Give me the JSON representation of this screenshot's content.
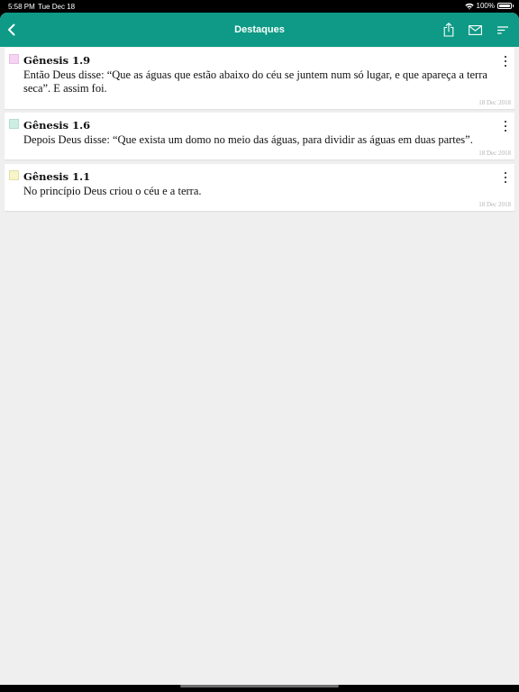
{
  "status_bar": {
    "time": "5:58 PM",
    "date": "Tue Dec 18",
    "battery": "100%",
    "icons": [
      "wifi-icon",
      "battery-icon"
    ]
  },
  "nav": {
    "title": "Destaques",
    "back_icon": "chevron-left-icon",
    "actions": [
      "share-icon",
      "mail-icon",
      "sort-icon"
    ]
  },
  "colors": {
    "accent": "#0e9a86",
    "background": "#efefef",
    "card": "#ffffff",
    "date_text": "#b3b3b3"
  },
  "highlights": [
    {
      "reference": "Gênesis 1.9",
      "text": "Então Deus disse: “Que as águas que estão abaixo do céu se juntem num só lugar, e que apareça a terra seca”. E assim foi.",
      "date": "18 Dec 2018",
      "color": "#f8d2f2"
    },
    {
      "reference": "Gênesis 1.6",
      "text": "Depois Deus disse: “Que exista um domo no meio das águas, para dividir as águas em duas partes”.",
      "date": "18 Dec 2018",
      "color": "#cdeee2"
    },
    {
      "reference": "Gênesis 1.1",
      "text": "No princípio Deus criou o céu e a terra.",
      "date": "18 Dec 2018",
      "color": "#f8f6c8"
    }
  ]
}
